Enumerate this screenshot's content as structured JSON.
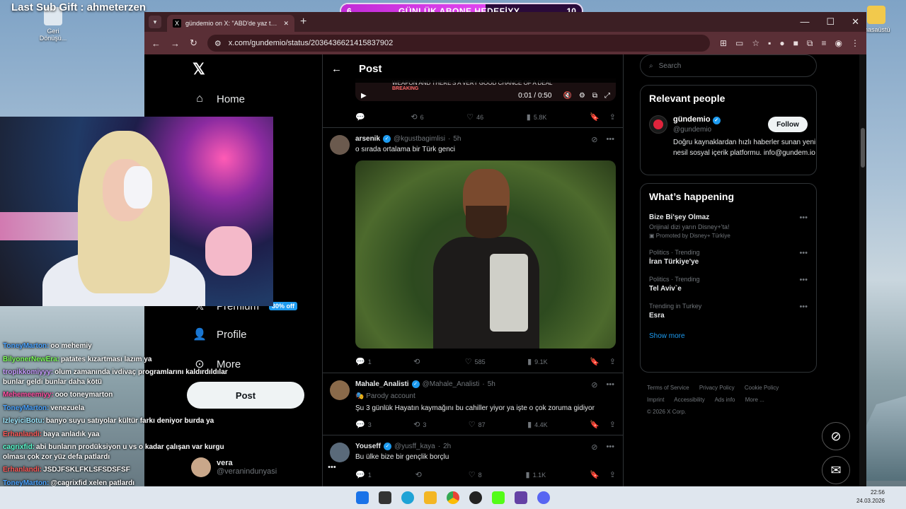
{
  "overlay": {
    "sub_gift": "Last Sub Gift : ahmeterzen",
    "goal": {
      "current": "6",
      "label": "GÜNLÜK ABONE HEDEFİYY",
      "target": "10",
      "progress": 0.6
    }
  },
  "desktop": {
    "recycle_label_1": "Geri",
    "recycle_label_2": "Dönüşü...",
    "right_label": "masaüstü"
  },
  "browser": {
    "tab_title": "gündemio on X: \"ABD'de yaz tatili",
    "url": "x.com/gundemio/status/2036436621415837902"
  },
  "nav": {
    "home": "Home",
    "premium": "Premium",
    "premium_badge": "30% off",
    "profile": "Profile",
    "more": "More",
    "post_button": "Post",
    "me_handle": "@veranindunyasi",
    "me_name": "vera"
  },
  "main": {
    "header": "Post",
    "video": {
      "line1": "WEAPON AND THERE'S A VERY GOOD CHANCE OF A DEAL",
      "line2": "BREAKING",
      "time": "0:01 / 0:50"
    },
    "first_actions": {
      "replies": "",
      "reposts": "6",
      "likes": "46",
      "views": "5.8K"
    },
    "tweets": [
      {
        "name": "arsenik",
        "handle": "@kgustbagimlisi",
        "time": "5h",
        "text": "o sırada ortalama bir Türk genci",
        "replies": "1",
        "reposts": "",
        "likes": "585",
        "views": "9.1K"
      },
      {
        "name": "Mahale_Analisti",
        "handle": "@Mahale_Analisti",
        "time": "5h",
        "label": "Parody account",
        "text": "Şu 3 günlük Hayatın kaymağını bu cahiller yiyor ya işte o çok zoruma gidiyor",
        "replies": "3",
        "reposts": "3",
        "likes": "87",
        "views": "4.4K"
      },
      {
        "name": "Youseff",
        "handle": "@yusff_kaya",
        "time": "2h",
        "text": "Bu ülke bize bir gençlik borçlu",
        "replies": "1",
        "reposts": "",
        "likes": "8",
        "views": "1.1K"
      }
    ]
  },
  "right": {
    "search_placeholder": "Search",
    "relevant": {
      "title": "Relevant people",
      "name": "gündemio",
      "handle": "@gundemio",
      "follow": "Follow",
      "bio": "Doğru kaynaklardan hızlı haberler sunan yeni nesil sosyal içerik platformu. info@gundem.io"
    },
    "happening": {
      "title": "What’s happening",
      "items": [
        {
          "meta": "",
          "title": "Bize Bi'şey Olmaz",
          "sub": "Orijinal dizi yarın Disney+'ta!",
          "promo": "Promoted by Disney+ Türkiye"
        },
        {
          "meta": "Politics · Trending",
          "title": "İran Türkiye'ye"
        },
        {
          "meta": "Politics · Trending",
          "title": "Tel Aviv`e"
        },
        {
          "meta": "Trending in Turkey",
          "title": "Esra"
        }
      ],
      "show_more": "Show more"
    },
    "footer": [
      "Terms of Service",
      "Privacy Policy",
      "Cookie Policy",
      "Imprint",
      "Accessibility",
      "Ads info",
      "More ...",
      "© 2026 X Corp."
    ]
  },
  "chat": [
    {
      "user": "ToneyMarton:",
      "color": "#4aa3ff",
      "text": "oo mehemiy"
    },
    {
      "user": "BilyonerNewEra:",
      "color": "#7dff5a",
      "text": "patates kızartması lazım ya"
    },
    {
      "user": "tropikkomiyyy:",
      "color": "#c79bff",
      "text": "olum zamanında ivdivaç programlarını kaldırdıldılar bunlar geldi bunlar daha kötü"
    },
    {
      "user": "Mehemeemiyy:",
      "color": "#ff4fa3",
      "text": "ooo toneymarton"
    },
    {
      "user": "ToneyMarton:",
      "color": "#4aa3ff",
      "text": "venezuela"
    },
    {
      "user": "IzleyiciBotu:",
      "color": "#9ee8ff",
      "text": "banyo suyu satıyolar kültür farkı deniyor burda ya"
    },
    {
      "user": "Erhanlandi:",
      "color": "#ff5a5a",
      "text": "baya anladık yaa"
    },
    {
      "user": "cagrixfid:",
      "color": "#5affd0",
      "text": "abi bunların prodüksiyon u vs o kadar çalışan var kurgu olması çok zor yüz defa patlardı"
    },
    {
      "user": "Erhanlandi:",
      "color": "#ff5a5a",
      "text": "JSDJFSKLFKLSFSDSFSF"
    },
    {
      "user": "ToneyMarton:",
      "color": "#4aa3ff",
      "text": "@cagrixfid xelen patlardı"
    }
  ],
  "taskbar": {
    "time": "22:56",
    "date": "24.03.2026"
  },
  "colors": {
    "accent": "#1d9bf0",
    "goal_fill": "#d63ae6",
    "browser_frame": "#5a2f36"
  }
}
